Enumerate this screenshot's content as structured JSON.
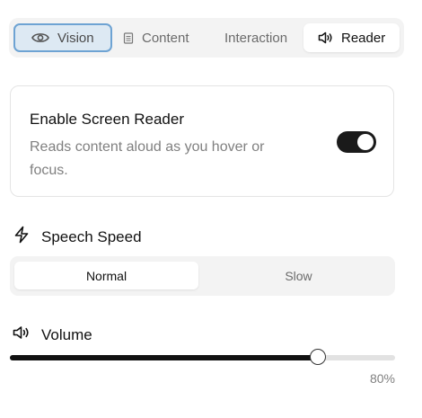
{
  "tabs": [
    {
      "label": "Vision",
      "icon": "eye-icon",
      "state": "focused"
    },
    {
      "label": "Content",
      "icon": "document-icon",
      "state": "inactive"
    },
    {
      "label": "Interaction",
      "icon": "",
      "state": "inactive"
    },
    {
      "label": "Reader",
      "icon": "speaker-icon",
      "state": "active"
    }
  ],
  "screen_reader": {
    "title": "Enable Screen Reader",
    "description": "Reads content aloud as you hover or focus.",
    "enabled": true
  },
  "speech_speed": {
    "heading": "Speech Speed",
    "icon": "lightning-icon",
    "options": [
      "Normal",
      "Slow"
    ],
    "selected": "Normal"
  },
  "volume": {
    "heading": "Volume",
    "icon": "speaker-icon",
    "value": 0.8,
    "value_label": "80%"
  },
  "colors": {
    "accent_focus": "#6ea3d3",
    "focus_bg": "#dde9f3",
    "toggle_on": "#1a1a1a",
    "slider_fill": "#111111"
  }
}
